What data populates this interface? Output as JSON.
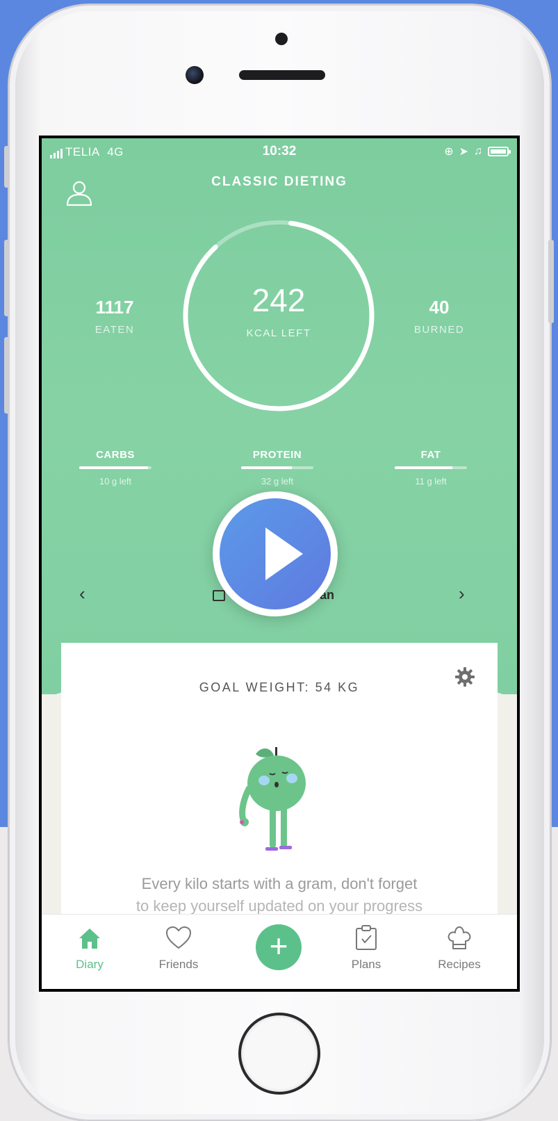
{
  "status_bar": {
    "carrier": "TELIA",
    "network": "4G",
    "time": "10:32"
  },
  "header": {
    "title": "CLASSIC DIETING"
  },
  "summary": {
    "eaten_value": "1117",
    "eaten_label": "EATEN",
    "kcal_left_value": "242",
    "kcal_left_label": "KCAL LEFT",
    "burned_value": "40",
    "burned_label": "BURNED",
    "ring_progress": 0.86
  },
  "macros": [
    {
      "name": "CARBS",
      "left": "10 g left",
      "progress": 0.95
    },
    {
      "name": "PROTEIN",
      "left": "32 g left",
      "progress": 0.7
    },
    {
      "name": "FAT",
      "left": "11 g left",
      "progress": 0.8
    }
  ],
  "date_nav": {
    "prev_glyph": "‹",
    "next_glyph": "›",
    "date_text": "an"
  },
  "goal": {
    "title": "GOAL WEIGHT: 54 KG",
    "message": "Every kilo starts with a gram, don't forget",
    "message_2": "to keep yourself updated on your progress"
  },
  "tab_bar": {
    "diary": "Diary",
    "friends": "Friends",
    "add": "+",
    "plans": "Plans",
    "recipes": "Recipes"
  },
  "colors": {
    "hero_green": "#82d0a3",
    "accent_green": "#5cc08a",
    "play_blue": "#5b88e4",
    "background_blue": "#5b87e0"
  },
  "icons": [
    "person-icon",
    "play-icon",
    "calendar-icon",
    "gear-icon",
    "home-icon",
    "heart-icon",
    "plus-icon",
    "clipboard-icon",
    "chef-hat-icon"
  ]
}
